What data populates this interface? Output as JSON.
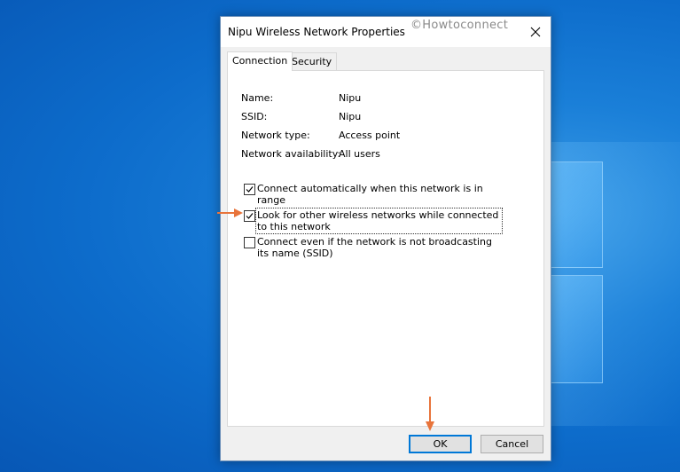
{
  "dialog": {
    "title": "Nipu Wireless Network Properties",
    "watermark": "©Howtoconnect"
  },
  "tabs": [
    {
      "label": "Connection",
      "active": true
    },
    {
      "label": "Security",
      "active": false
    }
  ],
  "properties": [
    {
      "label": "Name:",
      "value": "Nipu"
    },
    {
      "label": "SSID:",
      "value": "Nipu"
    },
    {
      "label": "Network type:",
      "value": "Access point"
    },
    {
      "label": "Network availability:",
      "value": "All users"
    }
  ],
  "options": [
    {
      "label": "Connect automatically when this network is in range",
      "checked": true
    },
    {
      "label": "Look for other wireless networks while connected to this network",
      "checked": true
    },
    {
      "label": "Connect even if the network is not broadcasting its name (SSID)",
      "checked": false
    }
  ],
  "buttons": {
    "ok": "OK",
    "cancel": "Cancel"
  },
  "colors": {
    "annotation_arrow": "#e8743b",
    "focus_border": "#0078d7"
  }
}
